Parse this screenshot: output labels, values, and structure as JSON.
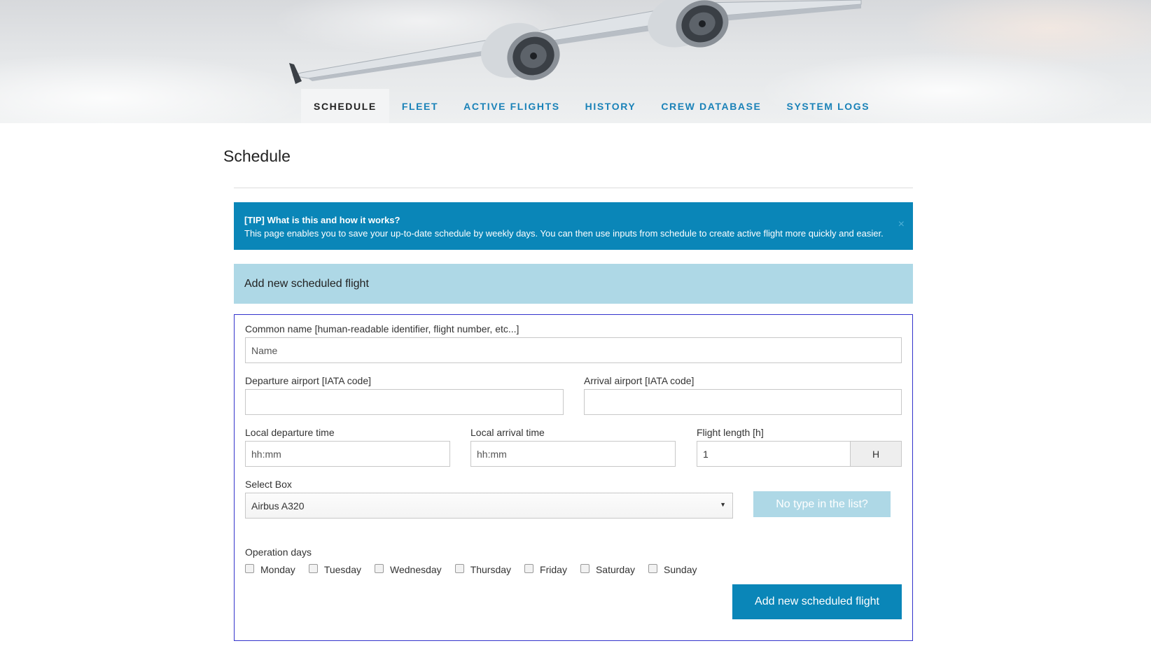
{
  "nav": {
    "items": [
      {
        "label": "SCHEDULE"
      },
      {
        "label": "FLEET"
      },
      {
        "label": "ACTIVE FLIGHTS"
      },
      {
        "label": "HISTORY"
      },
      {
        "label": "CREW DATABASE"
      },
      {
        "label": "SYSTEM LOGS"
      }
    ],
    "active_label": "SCHEDULE"
  },
  "page": {
    "title": "Schedule"
  },
  "tip": {
    "title": "[TIP] What is this and how it works?",
    "body": "This page enables you to save your up-to-date schedule by weekly days. You can then use inputs from schedule to create active flight more quickly and easier.",
    "close_glyph": "×"
  },
  "panel": {
    "header": "Add new scheduled flight"
  },
  "form": {
    "common_name": {
      "label": "Common name [human-readable identifier, flight number, etc...]",
      "placeholder": "Name"
    },
    "departure_airport": {
      "label": "Departure airport [IATA code]",
      "value": ""
    },
    "arrival_airport": {
      "label": "Arrival airport [IATA code]",
      "value": ""
    },
    "departure_time": {
      "label": "Local departure time",
      "placeholder": "hh:mm"
    },
    "arrival_time": {
      "label": "Local arrival time",
      "placeholder": "hh:mm"
    },
    "flight_length": {
      "label": "Flight length [h]",
      "value": "1",
      "addon": "H"
    },
    "aircraft_type": {
      "label": "Select Box",
      "selected": "Airbus A320"
    },
    "no_type_button": "No type in the list?",
    "operation_days": {
      "label": "Operation days",
      "days": [
        "Monday",
        "Tuesday",
        "Wednesday",
        "Thursday",
        "Friday",
        "Saturday",
        "Sunday"
      ]
    },
    "submit_button": "Add new scheduled flight"
  },
  "colors": {
    "accent": "#0a86b8",
    "nav_link": "#1a82b8",
    "panel_header_bg": "#aed8e6",
    "form_border": "#3333cc"
  }
}
